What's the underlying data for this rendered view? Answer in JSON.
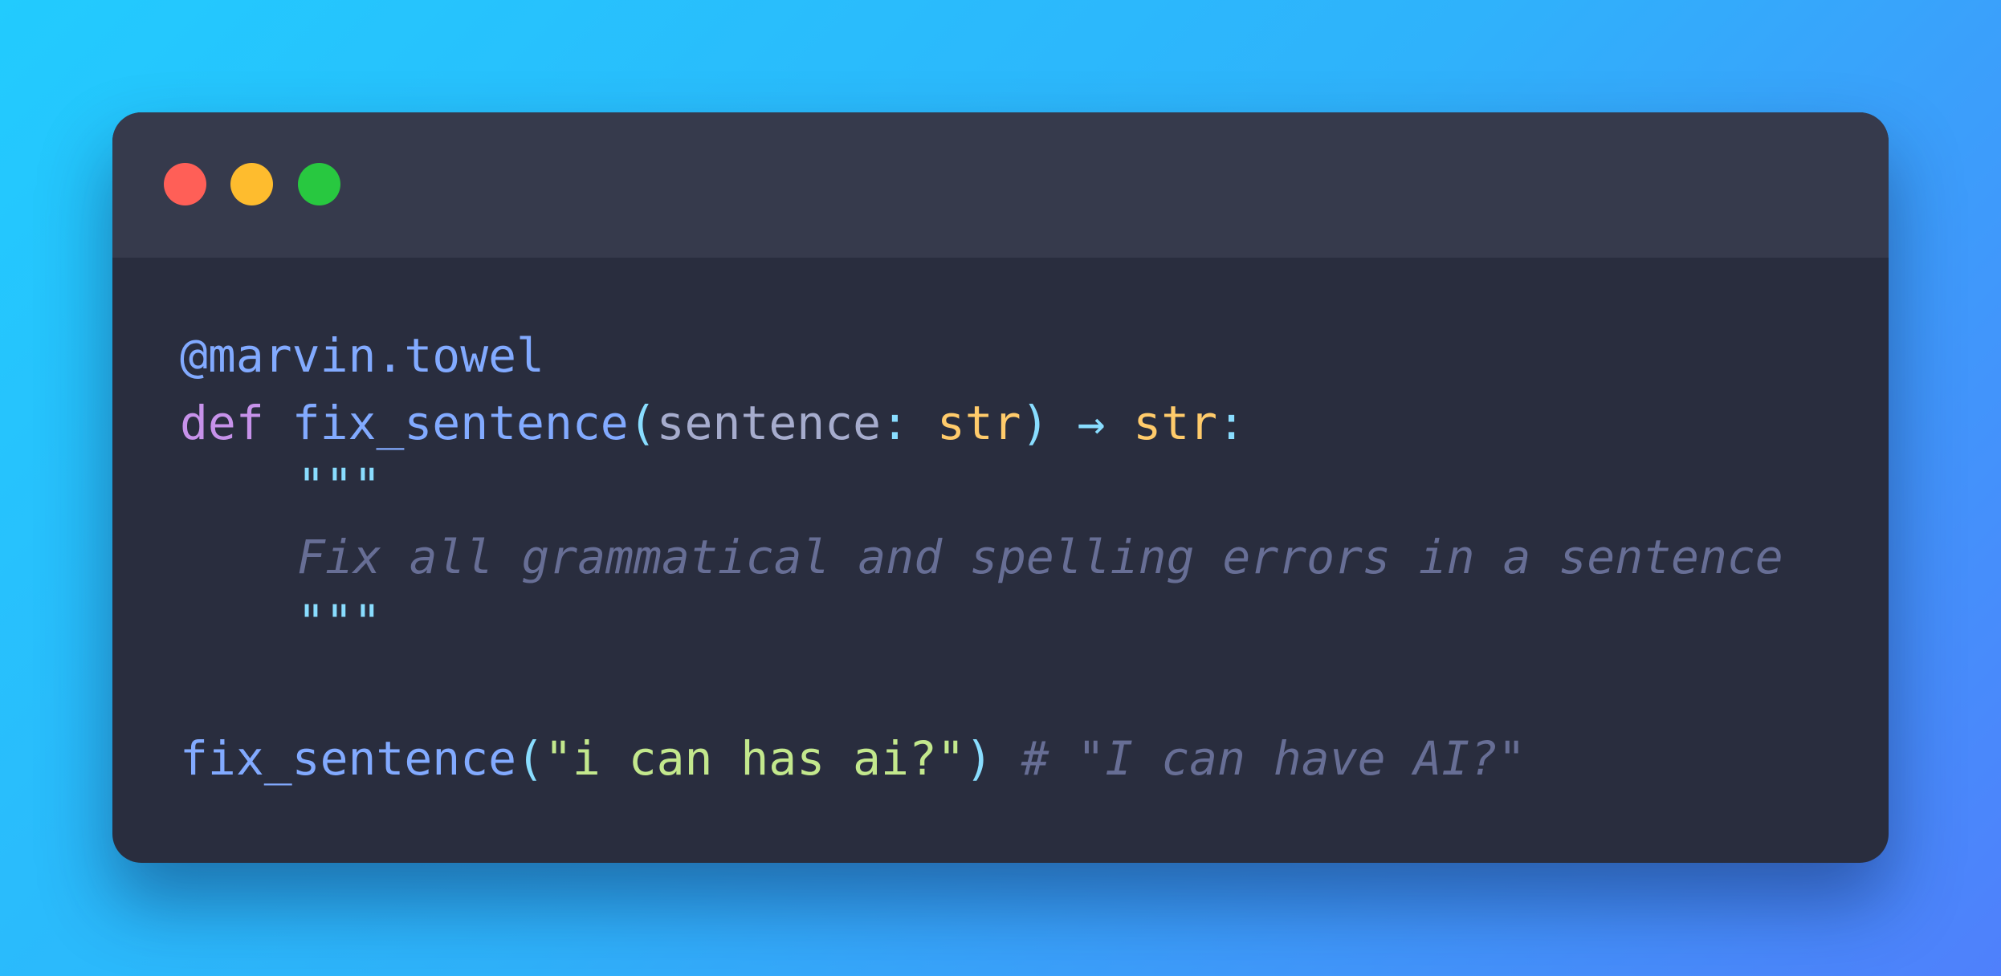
{
  "window": {
    "buttons": [
      {
        "name": "close",
        "color": "#ff5f57"
      },
      {
        "name": "minimize",
        "color": "#febc2e"
      },
      {
        "name": "maximize",
        "color": "#28c840"
      }
    ]
  },
  "colors": {
    "decorator": "#82aaff",
    "keyword": "#c792ea",
    "function": "#82aaff",
    "punctuation": "#89ddff",
    "param": "#a6accd",
    "type": "#ffcb6b",
    "string": "#c3e88d",
    "comment": "#676e95"
  },
  "code": {
    "line1": {
      "decorator": "@marvin.towel"
    },
    "line2": {
      "keyword": "def",
      "function_name": "fix_sentence",
      "open_paren": "(",
      "param": "sentence",
      "colon": ":",
      "type": "str",
      "close_paren": ")",
      "arrow": "→",
      "return_type": "str",
      "end_colon": ":"
    },
    "line3": {
      "docstring_open": "\"\"\""
    },
    "line4": {
      "docstring_text": "Fix all grammatical and spelling errors in a sentence"
    },
    "line5": {
      "docstring_close": "\"\"\""
    },
    "line7": {
      "call_name": "fix_sentence",
      "open_paren": "(",
      "string_arg": "\"i can has ai?\"",
      "close_paren": ")",
      "comment": "# \"I can have AI?\""
    }
  }
}
